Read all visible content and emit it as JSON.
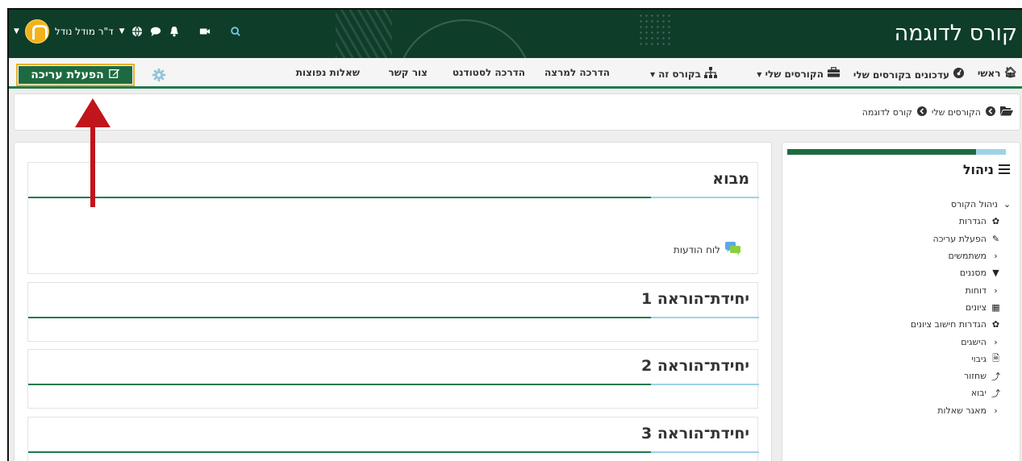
{
  "header": {
    "course_title": "קורס לדוגמה",
    "user_name": "ד\"ר מודל נודל"
  },
  "nav": {
    "home": "ראשי",
    "updates": "עדכונים בקורסים שלי",
    "my_courses": "הקורסים שלי",
    "this_course": "בקורס זה",
    "teacher_guide": "הדרכה למרצה",
    "student_guide": "הדרכה לסטודנט",
    "contact": "צור קשר",
    "faq": "שאלות נפוצות",
    "edit_button": "הפעלת עריכה"
  },
  "breadcrumb": {
    "my_courses": "הקורסים שלי",
    "course": "קורס לדוגמה"
  },
  "sections": [
    {
      "title": "מבוא"
    },
    {
      "title": "יחידת־הוראה 1"
    },
    {
      "title": "יחידת־הוראה 2"
    },
    {
      "title": "יחידת־הוראה 3"
    }
  ],
  "forum_link": "לוח הודעות",
  "sidebar": {
    "title": "ניהול",
    "items": [
      {
        "label": "ניהול הקורס",
        "icon": "chevron-down-icon"
      },
      {
        "label": "הגדרות",
        "icon": "gear-icon"
      },
      {
        "label": "הפעלת עריכה",
        "icon": "pencil-icon"
      },
      {
        "label": "משתמשים",
        "icon": "chevron-left-icon"
      },
      {
        "label": "מסננים",
        "icon": "filter-icon"
      },
      {
        "label": "דוחות",
        "icon": "chevron-left-icon"
      },
      {
        "label": "ציונים",
        "icon": "table-icon"
      },
      {
        "label": "הגדרות חישוב ציונים",
        "icon": "gear-icon"
      },
      {
        "label": "הישגים",
        "icon": "chevron-left-icon"
      },
      {
        "label": "גיבוי",
        "icon": "file-icon"
      },
      {
        "label": "שחזור",
        "icon": "upload-icon"
      },
      {
        "label": "יבוא",
        "icon": "upload-icon"
      },
      {
        "label": "מאגר שאלות",
        "icon": "chevron-left-icon"
      }
    ]
  },
  "colors": {
    "header_bg": "#0e3d2a",
    "accent_green": "#1e7a4b",
    "edit_button_bg": "#1e6a40",
    "highlight_border": "#e8b22a",
    "arrow": "#c0151b",
    "accent_blue": "#9fd2e8"
  }
}
